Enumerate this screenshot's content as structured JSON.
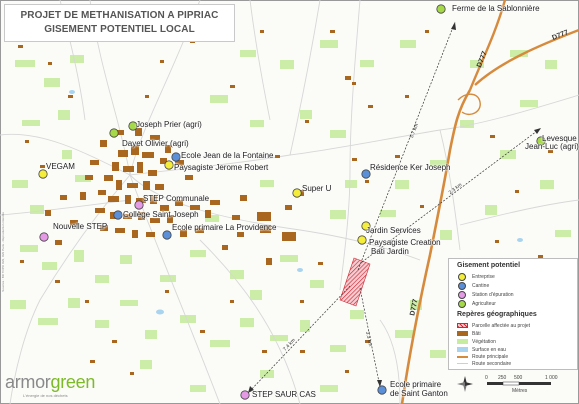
{
  "title": {
    "line1": "PROJET DE METHANISATION A PIPRIAC",
    "line2": "GISEMENT POTENTIEL LOCAL"
  },
  "colors": {
    "entreprise": "#f4ee3a",
    "cantine": "#5b8fd8",
    "station_epuration": "#e59ae6",
    "agriculteur": "#a6d94a",
    "parcelle": "#e8a1a8",
    "bati": "#a9661f",
    "vegetation": "#c8ec9f",
    "surface_eau": "#a9d4ef",
    "route_principale": "#d68a3c",
    "route_secondaire": "#d7d7d7"
  },
  "sites": [
    {
      "label": "Ferme de la Sablonnière",
      "type": "agriculteur"
    },
    {
      "label": "Joseph Prier (agri)",
      "type": "agriculteur"
    },
    {
      "label": "Dayet Olivier (agri)",
      "type": "agriculteur"
    },
    {
      "label": "Ecole Jean de la Fontaine",
      "type": "cantine"
    },
    {
      "label": "Paysagiste Jerome Robert",
      "type": "entreprise"
    },
    {
      "label": "VEGAM",
      "type": "entreprise"
    },
    {
      "label": "STEP Communale",
      "type": "station_epuration"
    },
    {
      "label": "Collège Saint Joseph",
      "type": "cantine"
    },
    {
      "label": "Nouvelle STEP",
      "type": "station_epuration"
    },
    {
      "label": "Ecole primaire La Providence",
      "type": "cantine"
    },
    {
      "label": "Super U",
      "type": "entreprise"
    },
    {
      "label": "Résidence Ker Joseph",
      "type": "cantine"
    },
    {
      "label": "Levesque Jean-Luc (agri)",
      "type": "agriculteur"
    },
    {
      "label": "Jardin Services",
      "type": "entreprise"
    },
    {
      "label": "Paysagiste Creation Bati Jardin",
      "type": "entreprise"
    },
    {
      "label": "Ecole primaire de Saint Ganton",
      "type": "cantine"
    },
    {
      "label": "STEP SAUR CAS",
      "type": "station_epuration"
    }
  ],
  "labels": {
    "ferme": "Ferme de la Sablonnière",
    "prier": "Joseph Prier (agri)",
    "dayet": "Dayet Olivier (agri)",
    "ecole_jdlf": "Ecole Jean de la Fontaine",
    "paysagiste_robert": "Paysagiste Jerome Robert",
    "vegam": "VEGAM",
    "step_communale": "STEP Communale",
    "college": "Collège Saint Joseph",
    "nouvelle_step": "Nouvelle STEP",
    "providence": "Ecole primaire La Providence",
    "superu": "Super U",
    "ker_joseph": "Résidence Ker Joseph",
    "levesque1": "Levesque",
    "levesque2": "Jean-Luc (agri)",
    "jardin": "Jardin Services",
    "creation1": "Paysagiste Creation",
    "creation2": "Bati Jardin",
    "ganton1": "Ecole primaire",
    "ganton2": "de Saint Ganton",
    "step_saur": "STEP SAUR CAS"
  },
  "roads": {
    "d777_ne": "D777",
    "d777_n": "D777",
    "d777_s": "D777"
  },
  "distances": {
    "ferme": "5.7 km",
    "levesque": "2.3 km",
    "ganton": "3.3 km",
    "step_saur": "7.4 km"
  },
  "legend": {
    "title1": "Gisement potentiel",
    "items1": [
      "Entreprise",
      "Cantine",
      "Station d'épuration",
      "Agriculteur"
    ],
    "title2": "Repères géographiques",
    "items2": [
      "Parcelle affectée au projet",
      "Bâti",
      "Végétation",
      "Surface en eau",
      "Route principale",
      "Route secondaire"
    ]
  },
  "scale": {
    "ticks": [
      "0",
      "250",
      "500",
      "1 000"
    ],
    "unit": "Mètres"
  },
  "brand": {
    "name_a": "armor",
    "name_b": "green",
    "tagline": "L'énergie de nos déchets"
  },
  "credit": "Sources : BD TOPO IGN, IGN Paris - Reproduction interdite"
}
